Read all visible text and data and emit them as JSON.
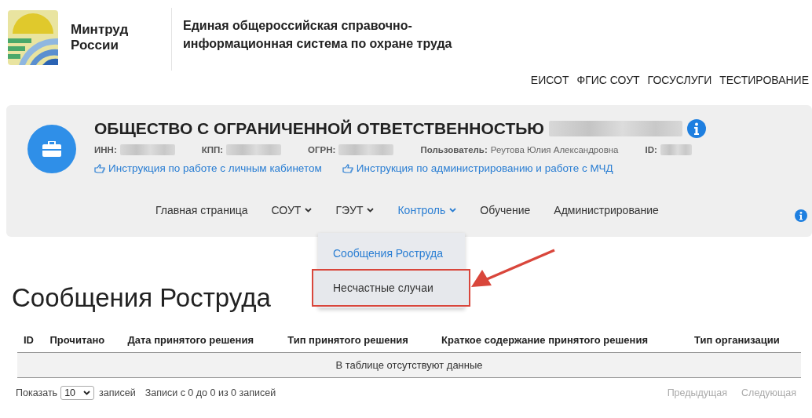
{
  "header": {
    "logo_text": [
      "Минтруд",
      "России"
    ],
    "system_title": [
      "Единая общероссийская справочно-",
      "информационная система по охране труда"
    ]
  },
  "top_links": [
    "ЕИСОТ",
    "ФГИС СОУТ",
    "ГОСУСЛУГИ",
    "ТЕСТИРОВАНИЕ"
  ],
  "organization": {
    "title": "ОБЩЕСТВО С ОГРАНИЧЕННОЙ ОТВЕТСТВЕННОСТЬЮ",
    "title_redacted": true,
    "fields": [
      {
        "label": "ИНН:",
        "kind": "redacted"
      },
      {
        "label": "КПП:",
        "kind": "redacted"
      },
      {
        "label": "ОГРН:",
        "kind": "redacted"
      },
      {
        "label": "Пользователь:",
        "kind": "text",
        "value": "Реутова Юлия Александровна"
      },
      {
        "label": "ID:",
        "kind": "redacted"
      }
    ],
    "links": [
      "Инструкция по работе с личным кабинетом",
      "Инструкция по администрированию и работе с МЧД"
    ]
  },
  "nav": [
    {
      "label": "Главная страница",
      "dropdown": false,
      "selected": false
    },
    {
      "label": "СОУТ",
      "dropdown": true,
      "selected": false
    },
    {
      "label": "ГЭУТ",
      "dropdown": true,
      "selected": false
    },
    {
      "label": "Контроль",
      "dropdown": true,
      "selected": true
    },
    {
      "label": "Обучение",
      "dropdown": false,
      "selected": false
    },
    {
      "label": "Администрирование",
      "dropdown": false,
      "selected": false
    }
  ],
  "dropdown_menu": [
    {
      "label": "Сообщения Роструда",
      "selected": true,
      "highlighted": false
    },
    {
      "label": "Несчастные случаи",
      "selected": false,
      "highlighted": true
    }
  ],
  "page_title": "Сообщения Роструда",
  "table": {
    "columns": [
      "ID",
      "Прочитано",
      "Дата принятого решения",
      "Тип принятого решения",
      "Краткое содержание принятого решения",
      "Тип организации"
    ],
    "empty_message": "В таблице отсутствуют данные"
  },
  "footer": {
    "show_label": "Показать",
    "page_size": "10",
    "records_label": "записей",
    "info": "Записи с 0 до 0 из 0 записей",
    "prev": {
      "label": "Предыдущая",
      "disabled": true
    },
    "next": {
      "label": "Следующая",
      "disabled": true
    }
  }
}
